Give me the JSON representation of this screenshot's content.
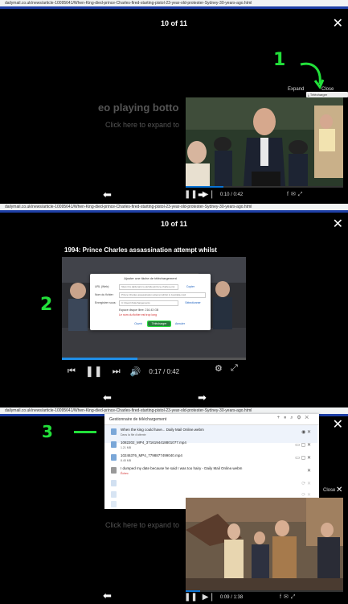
{
  "browser": {
    "url": "dailymail.co.uk/news/article-10095641/When-King-died-prince-Charles-fired-starting-pistol-23-year-old-protester-Sydney-30-years-ago.html"
  },
  "gallery": {
    "counter": "10 of 11",
    "close_label": "Close"
  },
  "panel1": {
    "ghost_heading": "eo playing botto",
    "ghost_sub": "Click here to expand to",
    "expand_label": "Expand",
    "close_label": "Close",
    "download_chip": "Télécharger",
    "annotation": "1",
    "time": "0:10 / 0:42"
  },
  "panel2": {
    "title": "1994: Prince Charles assassination attempt whilst",
    "annotation": "2",
    "time": "0:17 / 0:42",
    "modal": {
      "heading": "Ajouter une tâche de téléchargement",
      "url_label": "URL (Web):",
      "url_value": "https://vs.dailymail.co.uk/video/prince-charles-prot",
      "url_button": "Copier",
      "name_label": "Nom du fichier:",
      "name_value": "Prince Charles assassination attempt whilst in Australia.mp4",
      "save_label": "Enregistrer sous:",
      "save_value": "C:\\Users\\Téléchargements",
      "save_button": "Sélectionner",
      "space_label": "Espace disque libre:",
      "space_value": "216.43 GB",
      "warning": "Le nom du fichier est trop long",
      "btn_open": "Ouvrir",
      "btn_download": "Télécharger",
      "btn_cancel": "Annuler"
    }
  },
  "panel3": {
    "annotation": "3",
    "ghost_sub": "Click here to expand to",
    "close_label": "Close",
    "time": "0:09 / 1:38",
    "download_manager": {
      "title": "Gestionnaire de téléchargement",
      "items": [
        {
          "name": "When the king could have... Daily Mail Online.webm",
          "sub": "Dans la file d'attente"
        },
        {
          "name": "1082202_MP4_3716194418801077.mp4",
          "sub": "1.21 MB"
        },
        {
          "name": "10246376_MP4_7798877499040.mp4",
          "sub": "8.45 MB"
        },
        {
          "name": "I dumped my date because he said I was too hairy - Daily Mail Online.webm",
          "sub": "Échec"
        },
        {
          "name": "",
          "sub": ""
        },
        {
          "name": "",
          "sub": ""
        },
        {
          "name": "",
          "sub": ""
        }
      ]
    }
  }
}
